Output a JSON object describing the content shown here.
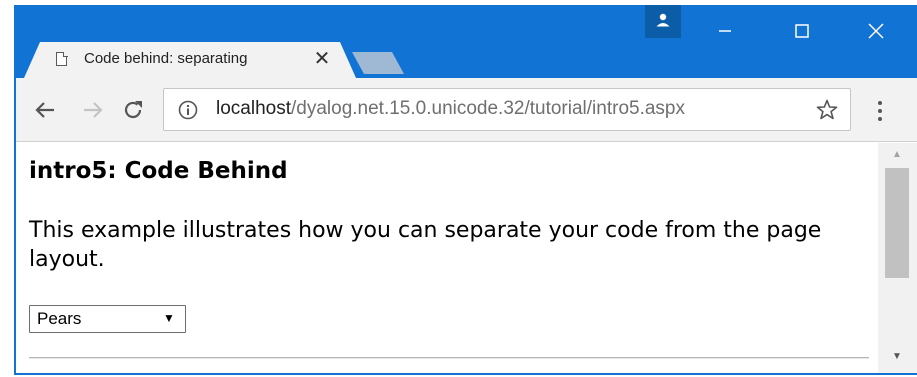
{
  "browser": {
    "tab": {
      "title": "Code behind: separating",
      "icon": "document-icon",
      "close_glyph": "✕"
    },
    "address": {
      "host": "localhost",
      "path": "/dyalog.net.15.0.unicode.32/tutorial/intro5.aspx"
    },
    "colors": {
      "titlebar": "#1173d4",
      "toolbar": "#f2f2f2"
    }
  },
  "page": {
    "heading": "intro5: Code Behind",
    "description": "This example illustrates how you can separate your code from the page layout.",
    "select": {
      "value": "Pears",
      "arrow": "▼"
    }
  }
}
